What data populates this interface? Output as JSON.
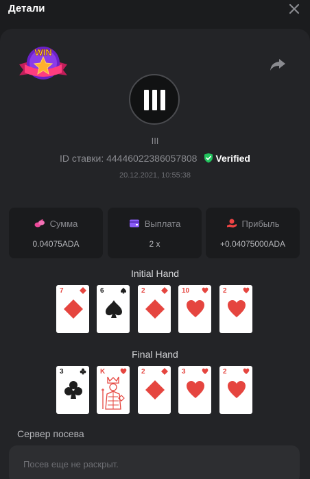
{
  "header": {
    "title": "Детали"
  },
  "badge": {
    "text": "WIN"
  },
  "game": {
    "name": "III"
  },
  "bet": {
    "id_text": "ID ставки: 44446022386057808",
    "verified_label": "Verified",
    "timestamp": "20.12.2021, 10:55:38"
  },
  "stats": [
    {
      "label": "Сумма",
      "value": "0.04075ADA"
    },
    {
      "label": "Выплата",
      "value": "2 x"
    },
    {
      "label": "Прибыль",
      "value": "+0.04075000ADA"
    }
  ],
  "initial_hand": {
    "title": "Initial Hand",
    "cards": [
      {
        "rank": "7",
        "suit": "diamond"
      },
      {
        "rank": "6",
        "suit": "spade"
      },
      {
        "rank": "2",
        "suit": "diamond"
      },
      {
        "rank": "10",
        "suit": "heart"
      },
      {
        "rank": "2",
        "suit": "heart"
      }
    ]
  },
  "final_hand": {
    "title": "Final Hand",
    "cards": [
      {
        "rank": "3",
        "suit": "club"
      },
      {
        "rank": "K",
        "suit": "heart"
      },
      {
        "rank": "2",
        "suit": "diamond"
      },
      {
        "rank": "3",
        "suit": "heart"
      },
      {
        "rank": "2",
        "suit": "heart"
      }
    ]
  },
  "seed": {
    "label": "Сервер посева",
    "placeholder": "Посев еще не раскрыт."
  },
  "colors": {
    "background": "#1b1c1e",
    "panel": "#232427",
    "verified_green": "#22c55e",
    "card_red": "#e5453f",
    "stat_amount_icon": "#ec4899",
    "stat_payout_icon": "#8b5cf6",
    "stat_profit_icon": "#ef4444"
  }
}
